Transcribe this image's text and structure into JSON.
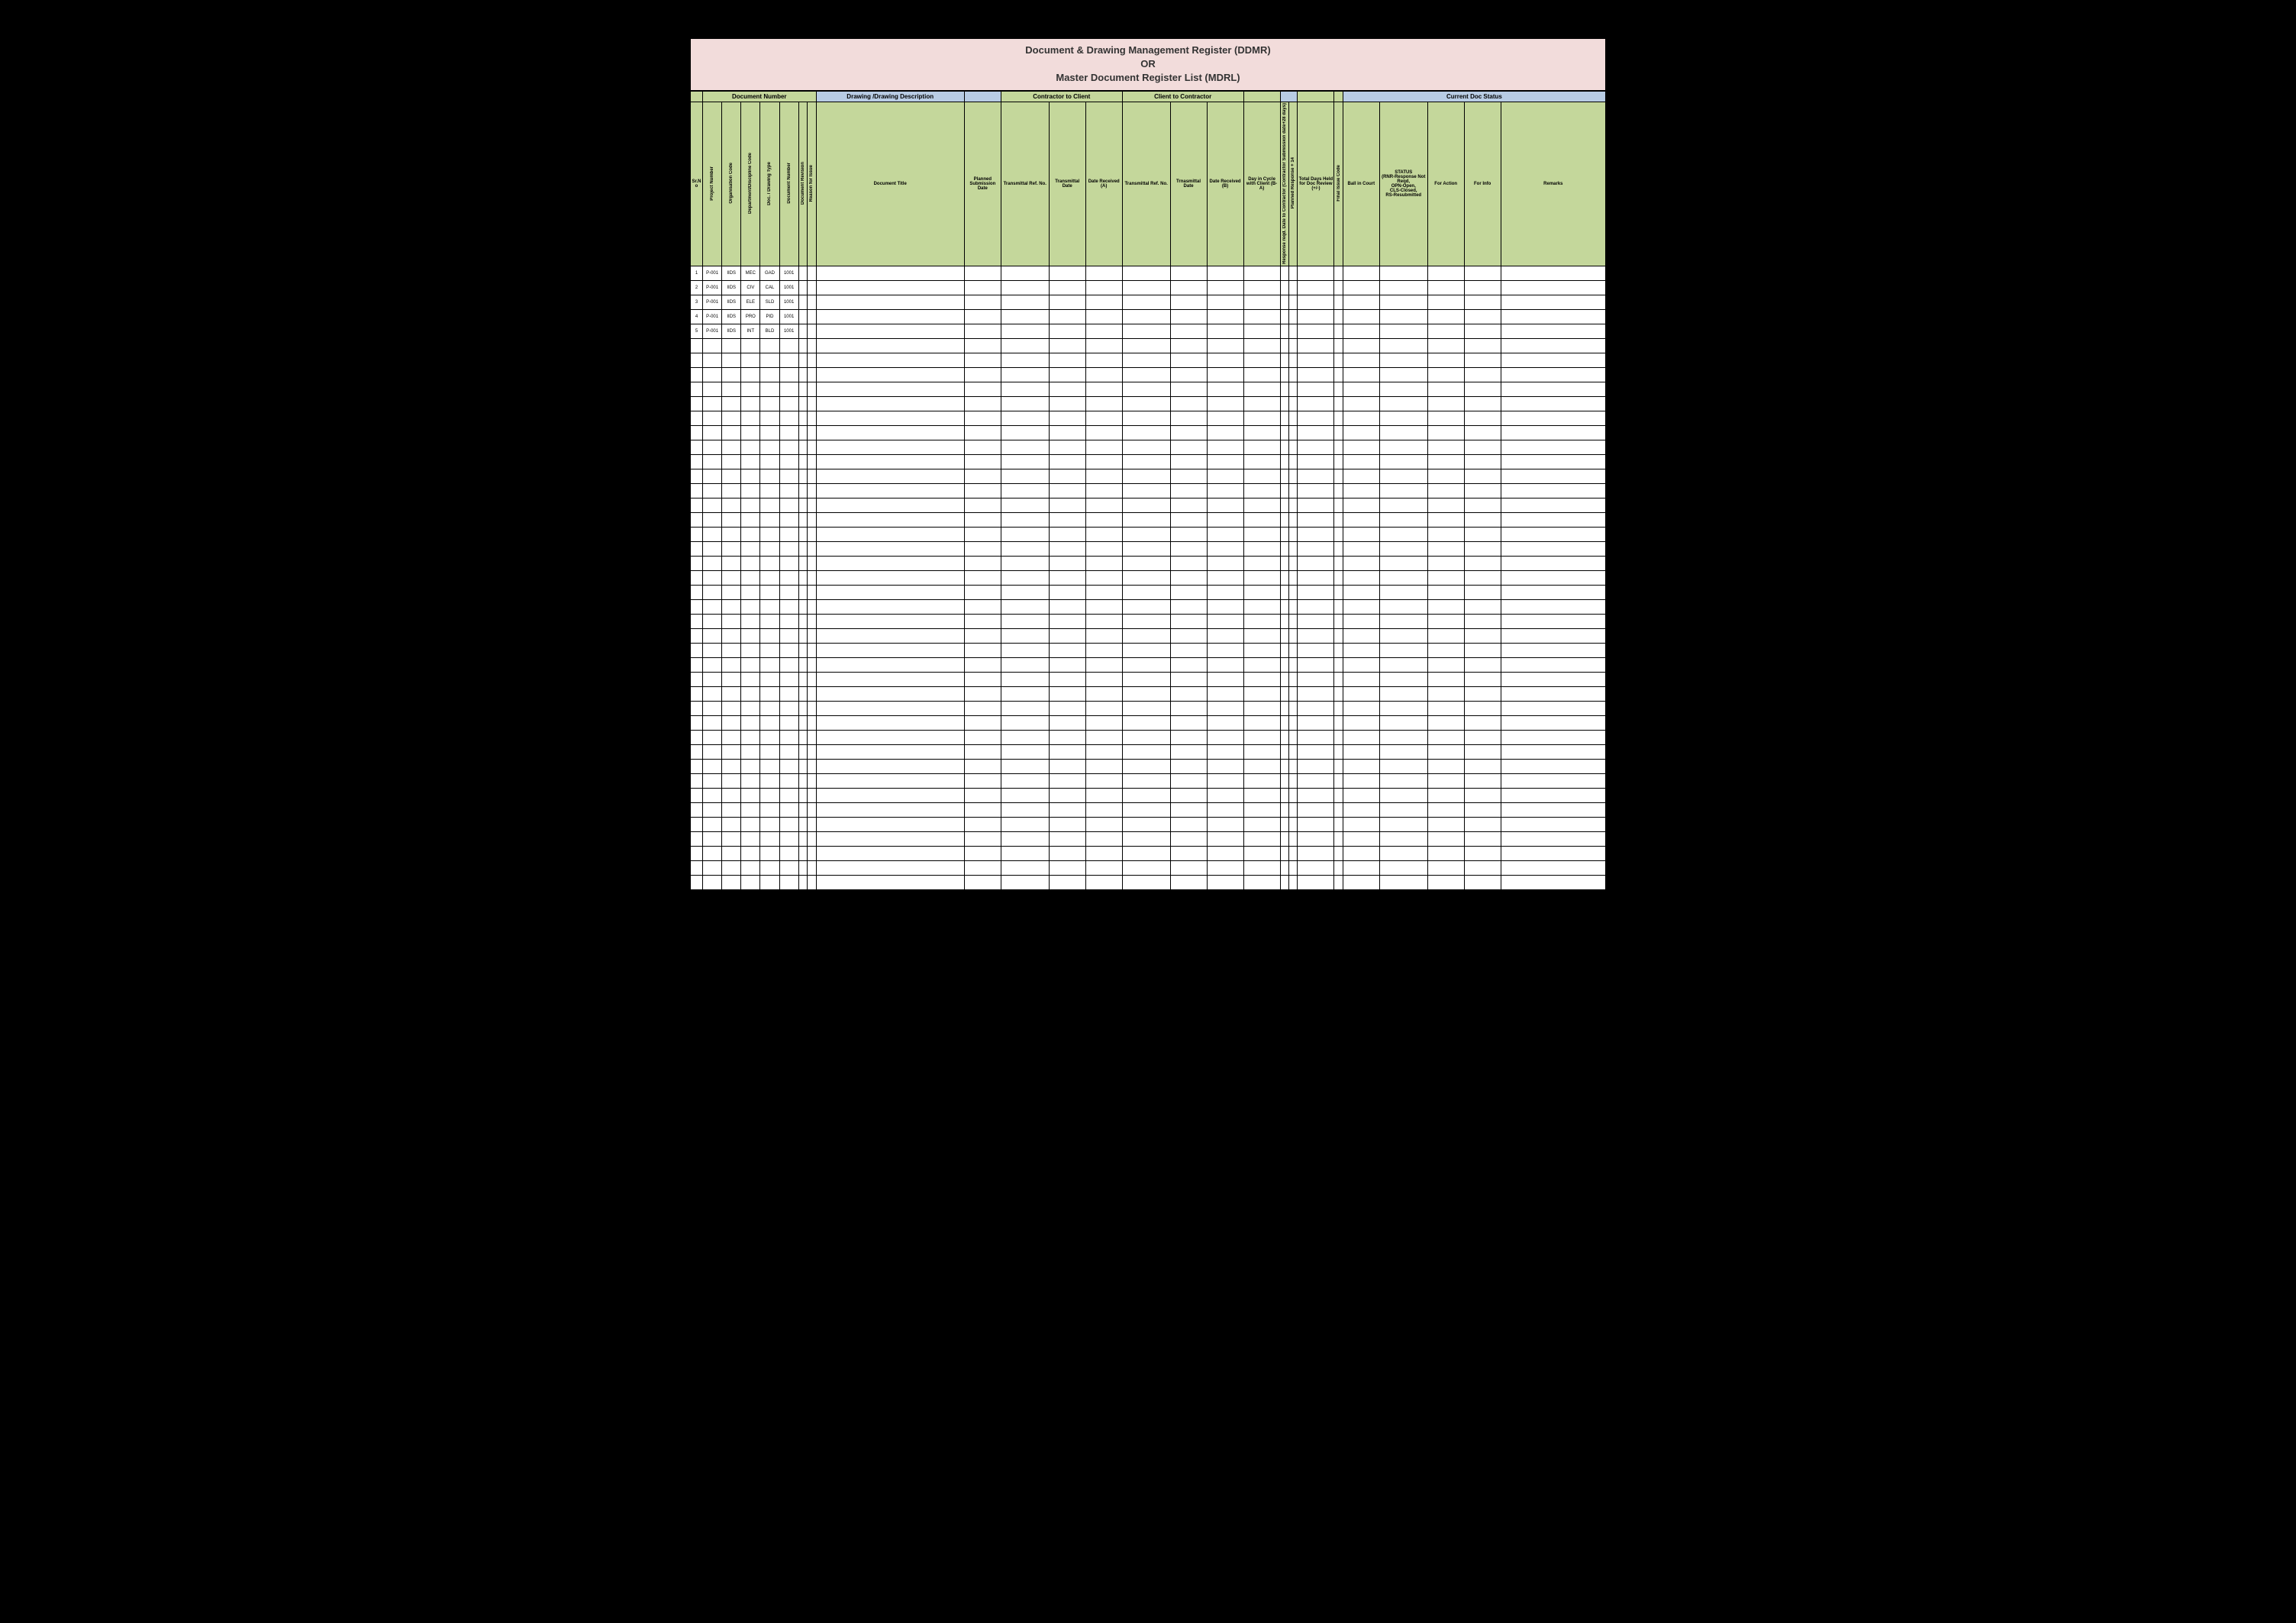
{
  "title": {
    "line1": "Document & Drawing Management Register (DDMR)",
    "line2": "OR",
    "line3": "Master Document Register List (MDRL)"
  },
  "sections": {
    "docnum": "Document Number",
    "drawdesc": "Drawing /Drawing Description",
    "c2c": "Contractor to Client",
    "cl2c": "Client  to Contractor",
    "status": "Current Doc Status"
  },
  "headers": {
    "srno": "Sr.No",
    "projnum": "Project Number",
    "orgcode": "Organisation Code",
    "deptcode": "Department/Discipline Code",
    "doctype": "Doc. / Drawing Type",
    "docnum": "Document Number",
    "docrev": "Document Revision",
    "reason": "Reason for  Issue",
    "doctitle": "Document Title",
    "planned": "Planned Submission Date",
    "transref1": "Transmittal Ref. No.",
    "transdate1": "Transmittal Date",
    "daterecvA": "Date Received (A)",
    "transref2": "Transmittal Ref. No.",
    "transdate2": "Trnasmittal Date",
    "daterecvB": "Date Received (B)",
    "dayscycle": "Day in Cycle with Client (B-A)",
    "respdate": "Response reqd.  Date to Contractor (Contractor Submission date+28 days)",
    "planrespA": "Planned Response + 14",
    "totaldays": "Total Days Held for Doc Review (+/-)",
    "finalcode": "Final Issue Code",
    "ballcourt": "Ball in Court",
    "statuscell": "STATUS\n(RNR-Response Not Reqd,\nOPN-Open,\nCLS-Closed,\nRS-Resubmitted",
    "foraction": "For Action",
    "forinfo": "For Info",
    "remarks": "Remarks"
  },
  "rows": [
    {
      "sr": "1",
      "proj": "P-001",
      "org": "IIDS",
      "dept": "MEC",
      "type": "GAD",
      "num": "1001"
    },
    {
      "sr": "2",
      "proj": "P-001",
      "org": "IIDS",
      "dept": "CIV",
      "type": "CAL",
      "num": "1001"
    },
    {
      "sr": "3",
      "proj": "P-001",
      "org": "IIDS",
      "dept": "ELE",
      "type": "SLD",
      "num": "1001"
    },
    {
      "sr": "4",
      "proj": "P-001",
      "org": "IIDS",
      "dept": "PRO",
      "type": "PID",
      "num": "1001"
    },
    {
      "sr": "5",
      "proj": "P-001",
      "org": "IIDS",
      "dept": "INT",
      "type": "BLD",
      "num": "1001"
    }
  ],
  "empty_row_count": 38
}
